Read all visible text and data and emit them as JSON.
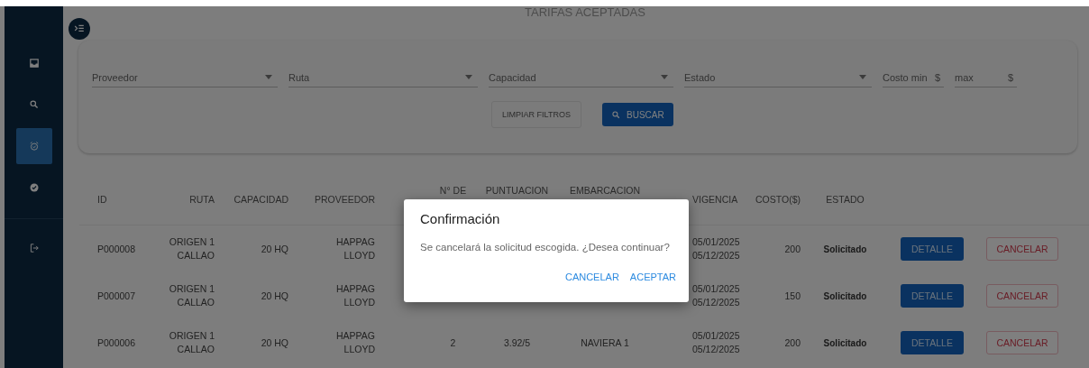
{
  "page": {
    "title": "TARIFAS ACEPTADAS"
  },
  "sidebar": {
    "items": [
      {
        "kind": "inbox",
        "selected": false
      },
      {
        "kind": "search",
        "selected": false
      },
      {
        "kind": "alarm",
        "selected": true
      },
      {
        "kind": "check",
        "selected": false
      },
      {
        "kind": "logout",
        "selected": false
      }
    ]
  },
  "filters": {
    "fields": [
      {
        "kind": "select",
        "label": "Proveedor"
      },
      {
        "kind": "select",
        "label": "Ruta"
      },
      {
        "kind": "select",
        "label": "Capacidad"
      },
      {
        "kind": "select",
        "label": "Estado"
      },
      {
        "kind": "money",
        "label": "Costo min",
        "suffix": "$"
      },
      {
        "kind": "money",
        "label": "max",
        "suffix": "$"
      }
    ],
    "clear_button": {
      "label": "LIMPIAR FILTROS",
      "disabled": true
    },
    "search_button": {
      "label": "BUSCAR"
    }
  },
  "table": {
    "columns": [
      "ID",
      "RUTA",
      "CAPACIDAD",
      "PROVEEDOR",
      "N° DE",
      "PUNTUACION",
      "EMBARCACION",
      "VIGENCIA",
      "COSTO($)",
      "ESTADO"
    ],
    "rows": [
      {
        "id": "P000008",
        "ruta": [
          "ORIGEN 1",
          "CALLAO"
        ],
        "capacidad": "20 HQ",
        "proveedor": [
          "HAPPAG",
          "LLOYD"
        ],
        "vigencia": [
          "05/01/2025",
          "05/12/2025"
        ],
        "costo": "200",
        "estado": "Solicitado",
        "actions": [
          {
            "kind": "primary",
            "label": "DETALLE"
          },
          {
            "kind": "danger",
            "label": "CANCELAR"
          }
        ]
      },
      {
        "id": "P000007",
        "ruta": [
          "ORIGEN 1",
          "CALLAO"
        ],
        "capacidad": "20 HQ",
        "proveedor": [
          "HAPPAG",
          "LLOYD"
        ],
        "vigencia": [
          "05/01/2025",
          "05/12/2025"
        ],
        "costo": "150",
        "estado": "Solicitado",
        "actions": [
          {
            "kind": "primary",
            "label": "DETALLE"
          },
          {
            "kind": "danger",
            "label": "CANCELAR"
          }
        ]
      },
      {
        "id": "P000006",
        "ruta": [
          "ORIGEN 1",
          "CALLAO"
        ],
        "capacidad": "20 HQ",
        "proveedor": [
          "HAPPAG",
          "LLOYD"
        ],
        "n_de": "2",
        "puntuacion": "3.92/5",
        "embarcacion": "NAVIERA 1",
        "vigencia": [
          "05/01/2025",
          "05/12/2025"
        ],
        "costo": "200",
        "estado": "Solicitado",
        "actions": [
          {
            "kind": "primary",
            "label": "DETALLE"
          },
          {
            "kind": "danger",
            "label": "CANCELAR"
          }
        ]
      }
    ]
  },
  "dialog": {
    "title": "Confirmación",
    "message": "Se cancelará la solicitud escogida. ¿Desea continuar?",
    "buttons": [
      {
        "label": "CANCELAR"
      },
      {
        "label": "ACEPTAR"
      }
    ]
  }
}
